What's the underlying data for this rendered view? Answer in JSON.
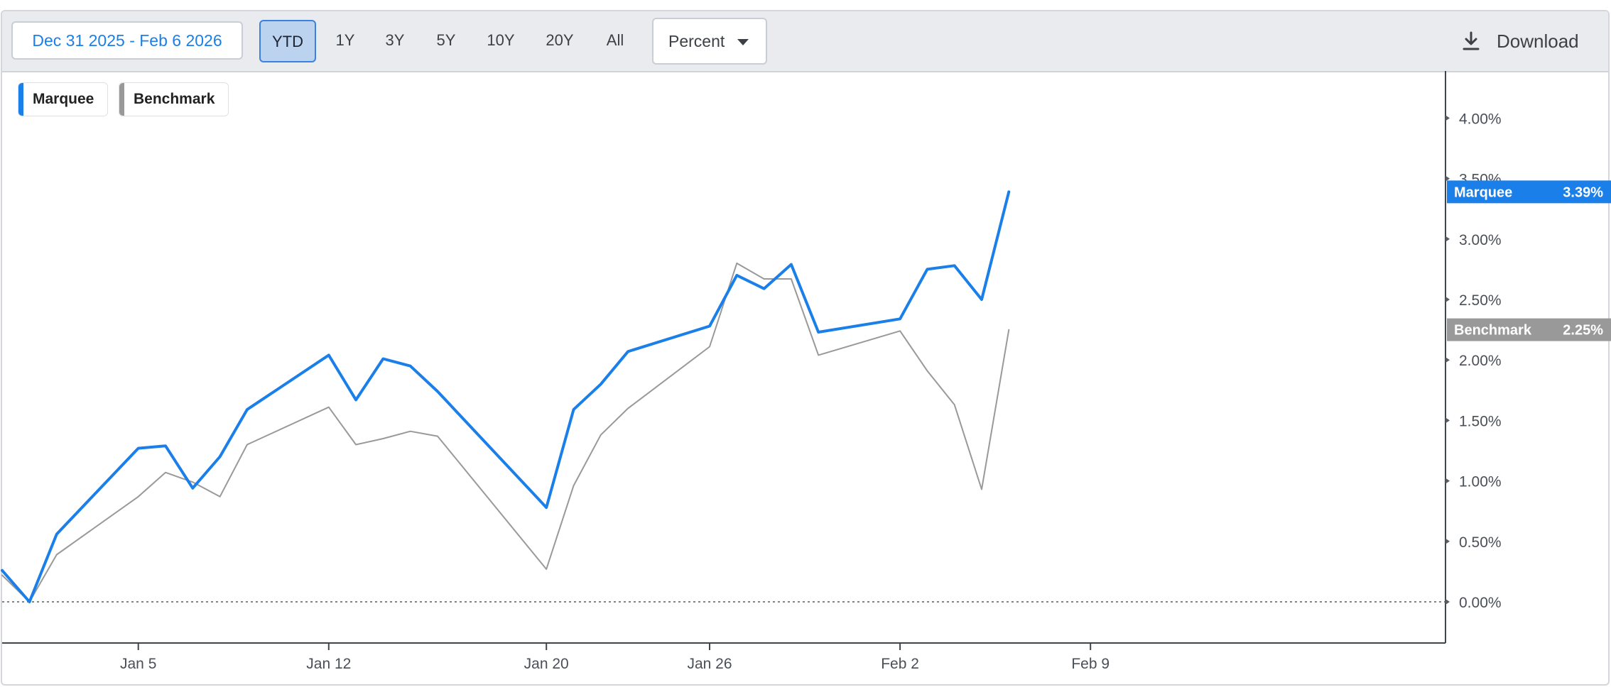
{
  "toolbar": {
    "date_range": "Dec 31 2025 - Feb 6 2026",
    "ranges": [
      "YTD",
      "1Y",
      "3Y",
      "5Y",
      "10Y",
      "20Y",
      "All"
    ],
    "active_range": "YTD",
    "mode": "Percent",
    "download_label": "Download"
  },
  "legend": [
    {
      "label": "Marquee",
      "color": "#1a7fe8"
    },
    {
      "label": "Benchmark",
      "color": "#999999"
    }
  ],
  "chart_data": {
    "type": "line",
    "x": [
      "2025-12-31",
      "2026-01-01",
      "2026-01-02",
      "2026-01-05",
      "2026-01-06",
      "2026-01-07",
      "2026-01-08",
      "2026-01-09",
      "2026-01-12",
      "2026-01-13",
      "2026-01-14",
      "2026-01-15",
      "2026-01-16",
      "2026-01-20",
      "2026-01-21",
      "2026-01-22",
      "2026-01-23",
      "2026-01-26",
      "2026-01-27",
      "2026-01-28",
      "2026-01-29",
      "2026-01-30",
      "2026-02-02",
      "2026-02-03",
      "2026-02-04",
      "2026-02-05",
      "2026-02-06"
    ],
    "series": [
      {
        "name": "Marquee",
        "color": "#1a7fe8",
        "values": [
          0.26,
          0.0,
          0.56,
          1.27,
          1.29,
          0.94,
          1.2,
          1.59,
          2.04,
          1.67,
          2.01,
          1.95,
          1.74,
          0.78,
          1.59,
          1.8,
          2.07,
          2.28,
          2.7,
          2.59,
          2.79,
          2.23,
          2.34,
          2.75,
          2.78,
          2.5,
          3.39
        ]
      },
      {
        "name": "Benchmark",
        "color": "#999999",
        "values": [
          0.22,
          0.0,
          0.39,
          0.87,
          1.07,
          0.99,
          0.87,
          1.3,
          1.61,
          1.3,
          1.35,
          1.41,
          1.37,
          0.27,
          0.96,
          1.38,
          1.6,
          2.11,
          2.8,
          2.67,
          2.67,
          2.04,
          2.24,
          1.91,
          1.63,
          0.93,
          2.25
        ]
      }
    ],
    "y_ticks": [
      "0.00%",
      "0.50%",
      "1.00%",
      "1.50%",
      "2.00%",
      "2.50%",
      "3.00%",
      "3.50%",
      "4.00%"
    ],
    "x_ticks": [
      "Jan 5",
      "Jan 12",
      "Jan 20",
      "Jan 26",
      "Feb 2",
      "Feb 9"
    ],
    "end_labels": [
      {
        "series": "Marquee",
        "value": "3.39%"
      },
      {
        "series": "Benchmark",
        "value": "2.25%"
      }
    ],
    "ylim": [
      -0.33,
      4.5
    ],
    "zero_line": "dotted",
    "legend_position": "top-left"
  }
}
